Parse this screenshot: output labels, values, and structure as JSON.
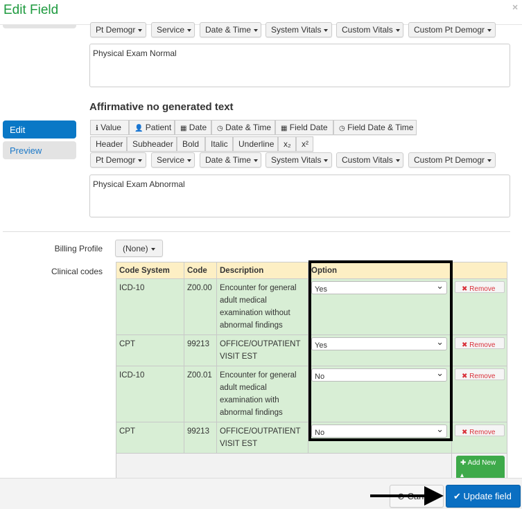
{
  "dialog": {
    "title": "Edit Field",
    "close": "×"
  },
  "sidebar": {
    "edit": "Edit",
    "preview": "Preview"
  },
  "insert_menus": [
    "Pt Demogr",
    "Service",
    "Date & Time",
    "System Vitals",
    "Custom Vitals",
    "Custom Pt Demogr"
  ],
  "affirmative_text": "Physical Exam Normal",
  "negative_section": {
    "heading": "Affirmative no generated text",
    "insert_buttons": [
      {
        "icon": "info-icon",
        "glyph": "ℹ",
        "label": "Value"
      },
      {
        "icon": "user-icon",
        "glyph": "👤",
        "label": "Patient"
      },
      {
        "icon": "calendar-icon",
        "glyph": "▦",
        "label": "Date"
      },
      {
        "icon": "clock-icon",
        "glyph": "◷",
        "label": "Date & Time"
      },
      {
        "icon": "calendar-icon",
        "glyph": "▦",
        "label": "Field Date"
      },
      {
        "icon": "clock-icon",
        "glyph": "◷",
        "label": "Field Date & Time"
      }
    ],
    "format_buttons": [
      "Header",
      "Subheader",
      "Bold",
      "Italic",
      "Underline",
      "x₂",
      "x²"
    ],
    "text": "Physical Exam Abnormal"
  },
  "billing": {
    "label": "Billing Profile",
    "value": "(None)"
  },
  "clinical_codes": {
    "label": "Clinical codes",
    "headers": [
      "Code System",
      "Code",
      "Description",
      "Option"
    ],
    "rows": [
      {
        "system": "ICD-10",
        "code": "Z00.00",
        "description": "Encounter for general adult medical examination without abnormal findings",
        "option": "Yes"
      },
      {
        "system": "CPT",
        "code": "99213",
        "description": "OFFICE/OUTPATIENT VISIT EST",
        "option": "Yes"
      },
      {
        "system": "ICD-10",
        "code": "Z00.01",
        "description": "Encounter for general adult medical examination with abnormal findings",
        "option": "No"
      },
      {
        "system": "CPT",
        "code": "99213",
        "description": "OFFICE/OUTPATIENT VISIT EST",
        "option": "No"
      }
    ],
    "remove_label": "Remove",
    "add_new_label": "Add New"
  },
  "footer": {
    "cancel": "Cancel",
    "update": "Update field"
  },
  "colors": {
    "title": "#1d9a3e",
    "primary": "#0a6fc2",
    "highlight": "#000000"
  }
}
